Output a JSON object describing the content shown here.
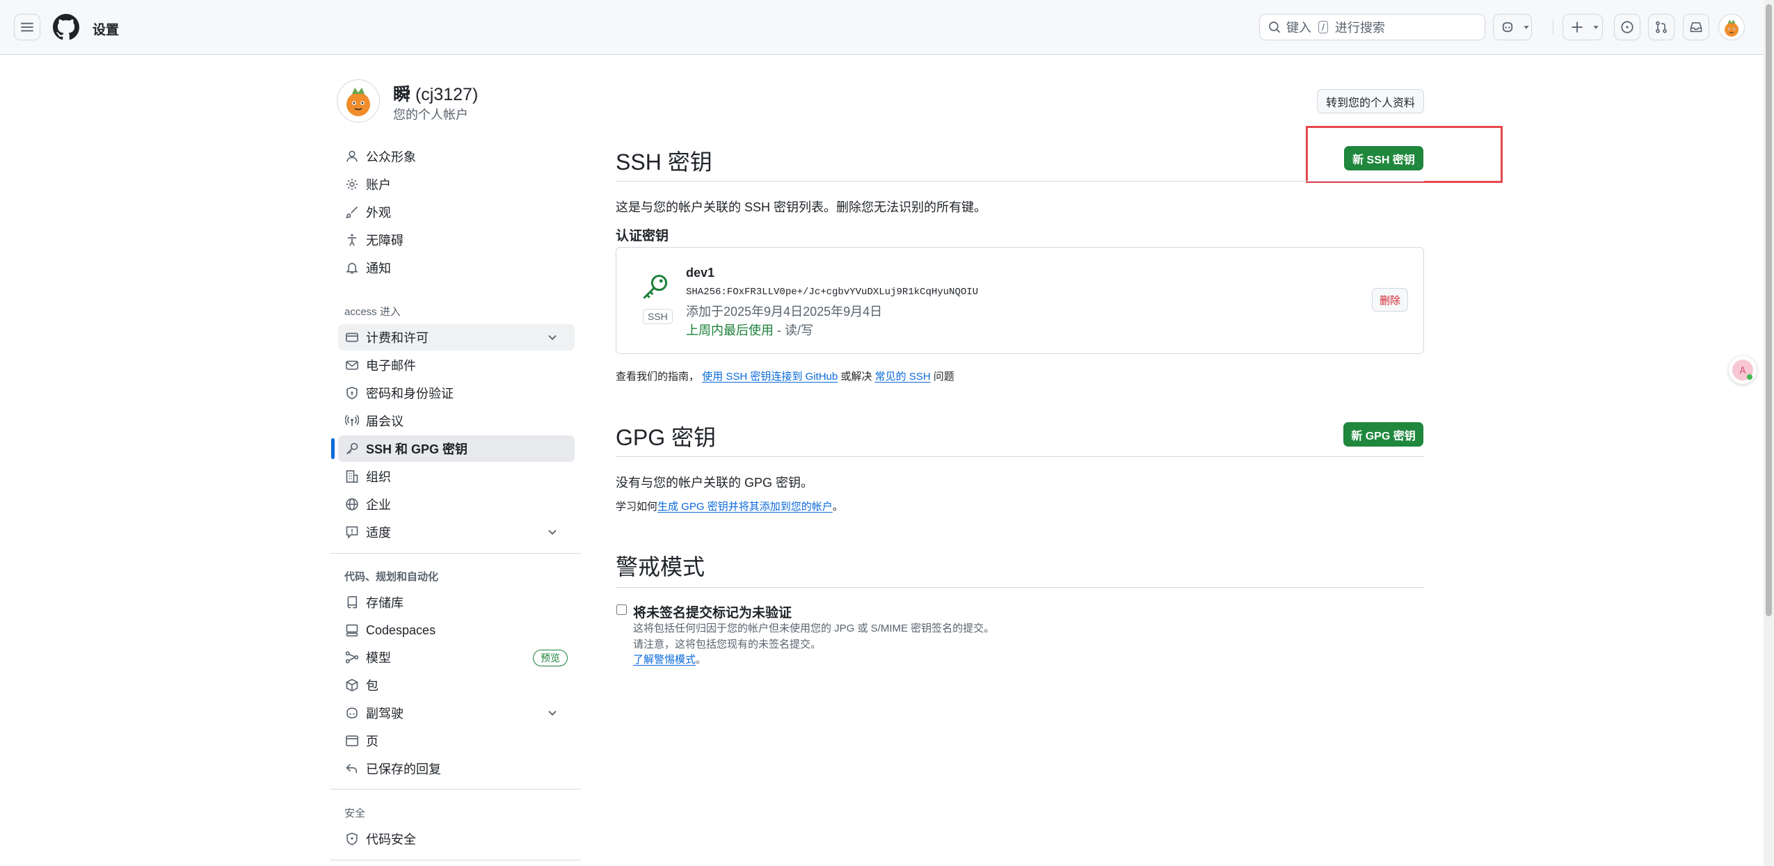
{
  "header": {
    "context": "设置",
    "search_before": "键入",
    "search_key": "/",
    "search_after": "进行搜索"
  },
  "profile": {
    "name": "瞬",
    "handle": "(cj3127)",
    "subtitle": "您的个人帐户",
    "profile_button": "转到您的个人资料"
  },
  "sidebar": {
    "items_top": [
      {
        "label": "公众形象",
        "icon": "person-icon"
      },
      {
        "label": "账户",
        "icon": "gear-icon"
      },
      {
        "label": "外观",
        "icon": "paintbrush-icon"
      },
      {
        "label": "无障碍",
        "icon": "accessibility-icon"
      },
      {
        "label": "通知",
        "icon": "bell-icon"
      }
    ],
    "group_access": "access 进入",
    "items_access": [
      {
        "label": "计费和许可",
        "icon": "credit-card-icon"
      },
      {
        "label": "电子邮件",
        "icon": "mail-icon"
      },
      {
        "label": "密码和身份验证",
        "icon": "shield-lock-icon"
      },
      {
        "label": "届会议",
        "icon": "broadcast-icon"
      },
      {
        "label": "SSH 和 GPG 密钥",
        "icon": "key-icon"
      },
      {
        "label": "组织",
        "icon": "organization-icon"
      },
      {
        "label": "企业",
        "icon": "globe-icon"
      },
      {
        "label": "适度",
        "icon": "report-icon"
      }
    ],
    "group_code": "代码、规划和自动化",
    "items_code": [
      {
        "label": "存储库",
        "icon": "repo-icon"
      },
      {
        "label": "Codespaces",
        "icon": "codespaces-icon"
      },
      {
        "label": "模型",
        "icon": "models-icon"
      },
      {
        "label": "包",
        "icon": "package-icon"
      },
      {
        "label": "副驾驶",
        "icon": "copilot-icon"
      },
      {
        "label": "页",
        "icon": "browser-icon"
      },
      {
        "label": "已保存的回复",
        "icon": "reply-icon"
      }
    ],
    "badge_preview": "预览",
    "group_security": "安全",
    "items_security": [
      {
        "label": "代码安全",
        "icon": "shield-check-icon"
      }
    ]
  },
  "ssh": {
    "title": "SSH 密钥",
    "new_button": "新 SSH 密钥",
    "description": "这是与您的帐户关联的 SSH 密钥列表。删除您无法识别的所有键。",
    "auth_heading": "认证密钥",
    "key": {
      "name": "dev1",
      "fingerprint": "SHA256:FOxFR3LLV0pe+/Jc+cgbvYVuDXLuj9R1kCqHyuNQOIU",
      "added": "添加于2025年9月4日2025年9月4日",
      "last_used": "上周内最后使用",
      "access": " - 读/写",
      "type_badge": "SSH",
      "delete_button": "删除"
    },
    "guide_prefix": "查看我们的指南，",
    "guide_link": "使用 SSH 密钥连接到 GitHub",
    "guide_middle": "或解决",
    "guide_link2": "常见的 SSH",
    "guide_suffix": "问题"
  },
  "gpg": {
    "title": "GPG 密钥",
    "new_button": "新 GPG 密钥",
    "description": "没有与您的帐户关联的 GPG 密钥。",
    "learn_prefix": "学习如何",
    "learn_link": "生成 GPG 密钥并将其添加到您的帐户",
    "learn_suffix": "。"
  },
  "vigilant": {
    "title": "警戒模式",
    "checkbox_label": "将未签名提交标记为未验证",
    "help1": "这将包括任何归因于您的帐户但未使用您的 JPG 或 S/MIME 密钥签名的提交。",
    "help2": "请注意，这将包括您现有的未签名提交。",
    "learn_link": "了解警惕模式",
    "learn_suffix": "。",
    "checked": false
  }
}
